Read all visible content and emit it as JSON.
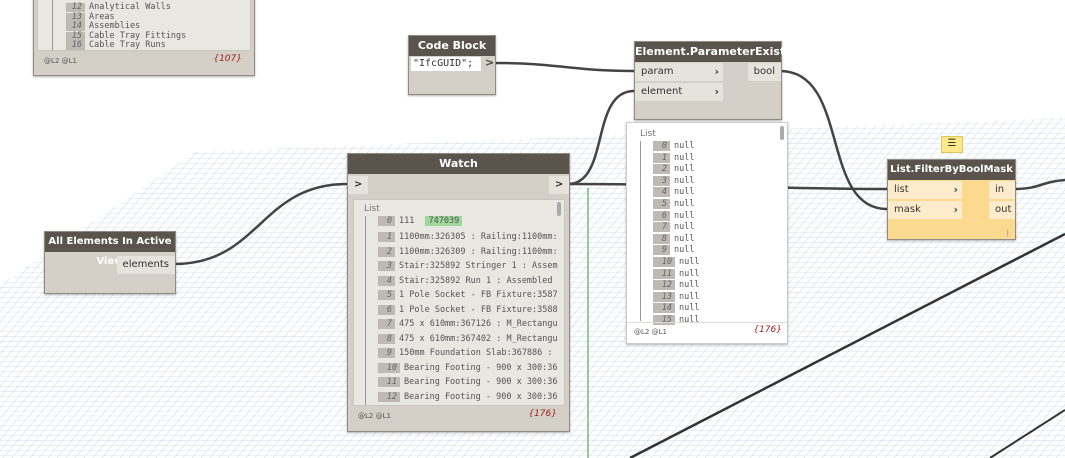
{
  "categories_node": {
    "items": [
      {
        "i": "12",
        "t": "Analytical Walls"
      },
      {
        "i": "13",
        "t": "Areas"
      },
      {
        "i": "14",
        "t": "Assemblies"
      },
      {
        "i": "15",
        "t": "Cable Tray Fittings"
      },
      {
        "i": "16",
        "t": "Cable Tray Runs"
      }
    ],
    "levels": "@L2 @L1",
    "count": "{107}"
  },
  "code_block": {
    "title": "Code Block",
    "code": "\"IfcGUID\";",
    "out": ">"
  },
  "param_exists": {
    "title": "Element.ParameterExists",
    "in1": "param",
    "in2": "element",
    "out": "bool",
    "preview": {
      "label": "List",
      "items": [
        {
          "i": "0",
          "t": "null"
        },
        {
          "i": "1",
          "t": "null"
        },
        {
          "i": "2",
          "t": "null"
        },
        {
          "i": "3",
          "t": "null"
        },
        {
          "i": "4",
          "t": "null"
        },
        {
          "i": "5",
          "t": "null"
        },
        {
          "i": "6",
          "t": "null"
        },
        {
          "i": "7",
          "t": "null"
        },
        {
          "i": "8",
          "t": "null"
        },
        {
          "i": "9",
          "t": "null"
        },
        {
          "i": "10",
          "t": "null"
        },
        {
          "i": "11",
          "t": "null"
        },
        {
          "i": "12",
          "t": "null"
        },
        {
          "i": "13",
          "t": "null"
        },
        {
          "i": "14",
          "t": "null"
        },
        {
          "i": "15",
          "t": "null"
        }
      ],
      "levels": "@L2 @L1",
      "count": "{176}"
    }
  },
  "watch": {
    "title": "Watch",
    "in": ">",
    "out": ">",
    "label": "List",
    "first_value": "111",
    "first_highlight": "747039",
    "items": [
      {
        "i": "1",
        "t": "1100mm:326305 : Railing:1100mm:"
      },
      {
        "i": "2",
        "t": "1100mm:326309 : Railing:1100mm:"
      },
      {
        "i": "3",
        "t": "Stair:325892 Stringer 1 : Assem"
      },
      {
        "i": "4",
        "t": "Stair:325892 Run 1 : Assembled"
      },
      {
        "i": "5",
        "t": "1 Pole Socket - FB Fixture:3587"
      },
      {
        "i": "6",
        "t": "1 Pole Socket - FB Fixture:3588"
      },
      {
        "i": "7",
        "t": "475 x 610mm:367126 : M_Rectangu"
      },
      {
        "i": "8",
        "t": "475 x 610mm:367402 : M_Rectangu"
      },
      {
        "i": "9",
        "t": "150mm Foundation Slab:367886 :"
      },
      {
        "i": "10",
        "t": "Bearing Footing - 900 x 300:36"
      },
      {
        "i": "11",
        "t": "Bearing Footing - 900 x 300:36"
      },
      {
        "i": "12",
        "t": "Bearing Footing - 900 x 300:36"
      }
    ],
    "first_index": "0",
    "levels": "@L2 @L1",
    "count": "{176}"
  },
  "all_elements": {
    "title": "All Elements In Active View",
    "out": "elements"
  },
  "filter": {
    "title": "List.FilterByBoolMask",
    "in1": "list",
    "in2": "mask",
    "out1": "in",
    "out2": "out",
    "lacing": "|"
  }
}
